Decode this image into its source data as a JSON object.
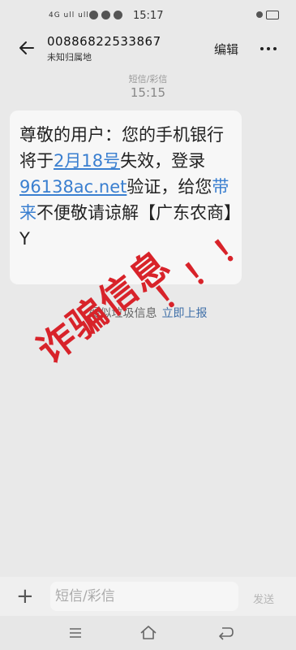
{
  "status_bar": {
    "signal": "4G ull ull",
    "time": "15:17"
  },
  "header": {
    "phone_number": "00886822533867",
    "location": "未知归属地",
    "edit_label": "编辑"
  },
  "conversation": {
    "type_label": "短信/彩信",
    "time": "15:15",
    "message": {
      "part1": "尊敬的用户：您的手机银行将于",
      "date": "2月18号",
      "part2": "失效，登录",
      "url": "96138ac.net",
      "part3": "验证，给您",
      "hl_word": "带来",
      "part4": "不便敬请谅解【广东农商】Y"
    },
    "spam_label": "疑似垃圾信息",
    "report_label": "立即上报"
  },
  "stamp": {
    "text": "诈骗信息",
    "bangs": "！！！",
    "color": "#d8232a"
  },
  "composer": {
    "placeholder": "短信/彩信",
    "send_label": "发送"
  },
  "colors": {
    "link": "#3a7fd0",
    "background": "#e9e9e9"
  }
}
